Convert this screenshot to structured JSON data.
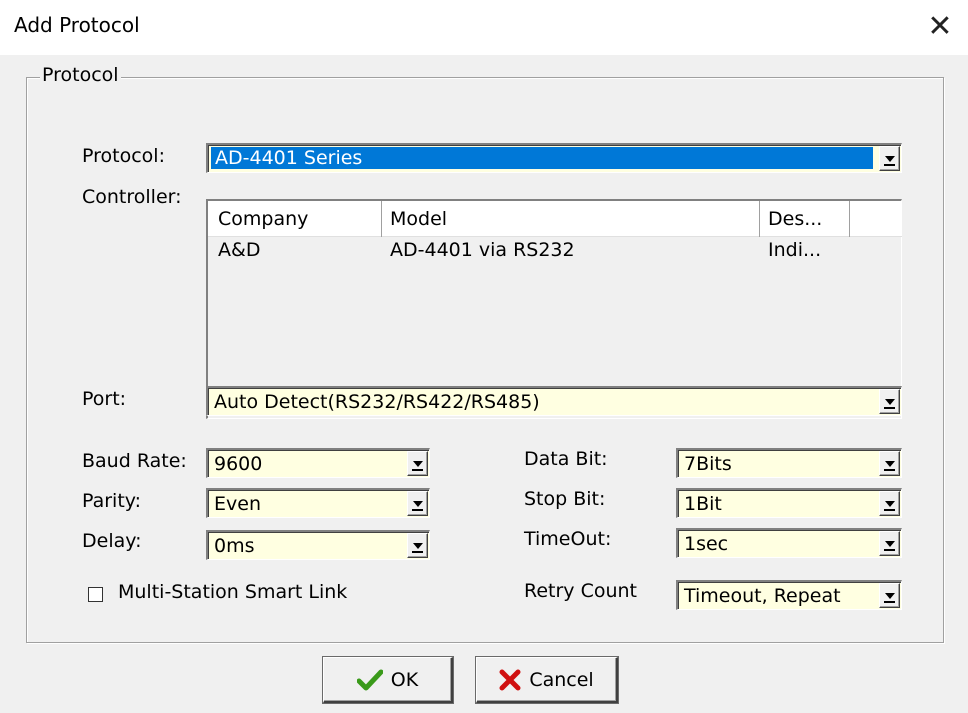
{
  "window": {
    "title": "Add Protocol",
    "close_glyph": "✕"
  },
  "group": {
    "title": "Protocol"
  },
  "protocol": {
    "label": "Protocol:",
    "value": "AD-4401 Series"
  },
  "controller": {
    "label": "Controller:",
    "columns": [
      "Company",
      "Model",
      "Des..."
    ],
    "rows": [
      [
        "A&D",
        "AD-4401 via RS232",
        "Indi..."
      ]
    ]
  },
  "port": {
    "label": "Port:",
    "value": "Auto Detect(RS232/RS422/RS485)"
  },
  "baud_rate": {
    "label": "Baud Rate:",
    "value": "9600"
  },
  "parity": {
    "label": "Parity:",
    "value": "Even"
  },
  "delay": {
    "label": "Delay:",
    "value": "0ms"
  },
  "data_bit": {
    "label": "Data Bit:",
    "value": "7Bits"
  },
  "stop_bit": {
    "label": "Stop Bit:",
    "value": "1Bit"
  },
  "timeout": {
    "label": "TimeOut:",
    "value": "1sec"
  },
  "retry_count": {
    "label": "Retry Count",
    "value": "Timeout, Repeat"
  },
  "multi_station": {
    "label": "Multi-Station Smart Link",
    "checked": false
  },
  "buttons": {
    "ok": "OK",
    "cancel": "Cancel"
  },
  "colors": {
    "selection": "#0078d7",
    "field_background": "#ffffe1",
    "dialog_background": "#f0f0f0",
    "ok_icon": "#3a9a1a",
    "cancel_icon": "#d01010"
  },
  "icons": {
    "close": "close-icon",
    "dropdown": "chevron-down-icon",
    "ok": "checkmark-icon",
    "cancel": "x-icon"
  }
}
